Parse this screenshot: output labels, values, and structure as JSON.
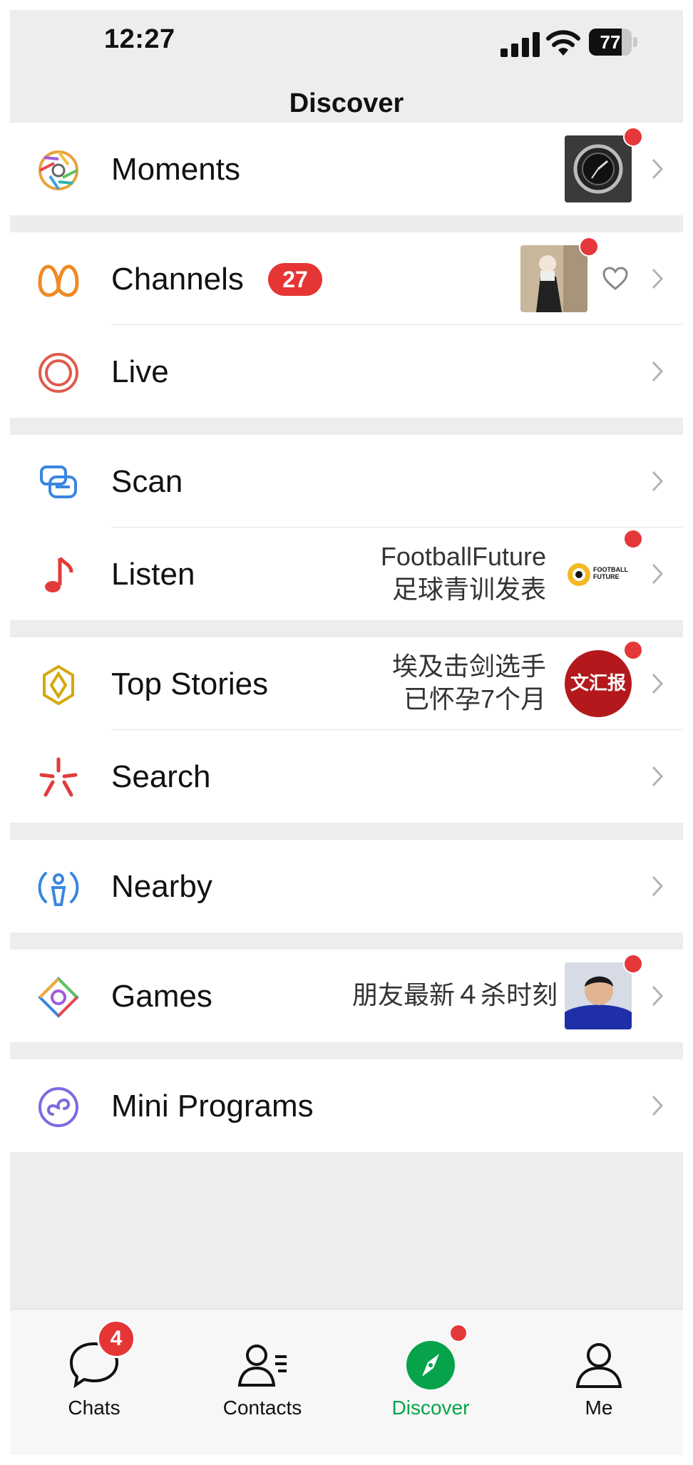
{
  "status_bar": {
    "time": "12:27",
    "battery": "77",
    "battery_percent": 77
  },
  "nav": {
    "title": "Discover"
  },
  "rows": {
    "moments": {
      "label": "Moments",
      "thumb_icon": "watch-photo"
    },
    "channels": {
      "label": "Channels",
      "badge": "27",
      "thumb_icon": "person-photo",
      "like_icon": "heart-icon"
    },
    "live": {
      "label": "Live"
    },
    "scan": {
      "label": "Scan"
    },
    "listen": {
      "label": "Listen",
      "side_line1": "FootballFuture",
      "side_line2": "足球青训发表",
      "logo_text": "FOOTBALL FUTURE"
    },
    "top_stories": {
      "label": "Top Stories",
      "side_line1": "埃及击剑选手",
      "side_line2": "已怀孕7个月",
      "logo_text": "文汇报"
    },
    "search": {
      "label": "Search"
    },
    "nearby": {
      "label": "Nearby"
    },
    "games": {
      "label": "Games",
      "side_line1": "朋友最新４杀时刻",
      "thumb_icon": "player-avatar"
    },
    "mini_programs": {
      "label": "Mini Programs"
    }
  },
  "tabbar": {
    "chats": {
      "label": "Chats",
      "badge": "4"
    },
    "contacts": {
      "label": "Contacts"
    },
    "discover": {
      "label": "Discover"
    },
    "me": {
      "label": "Me"
    }
  },
  "colors": {
    "accent": "#07a34a",
    "badge_red": "#e53535",
    "background": "#ededed"
  }
}
